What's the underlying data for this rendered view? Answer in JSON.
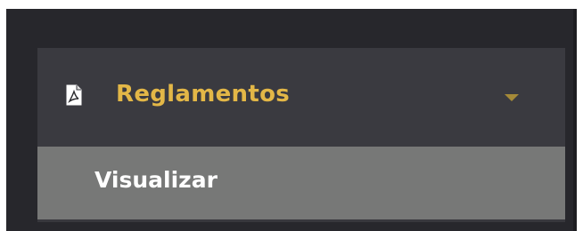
{
  "menu": {
    "title": "Reglamentos",
    "icon": "pdf-file-icon",
    "expand_icon": "chevron-down-icon",
    "accent_color": "#e3b747",
    "items": [
      {
        "label": "Visualizar"
      }
    ]
  }
}
